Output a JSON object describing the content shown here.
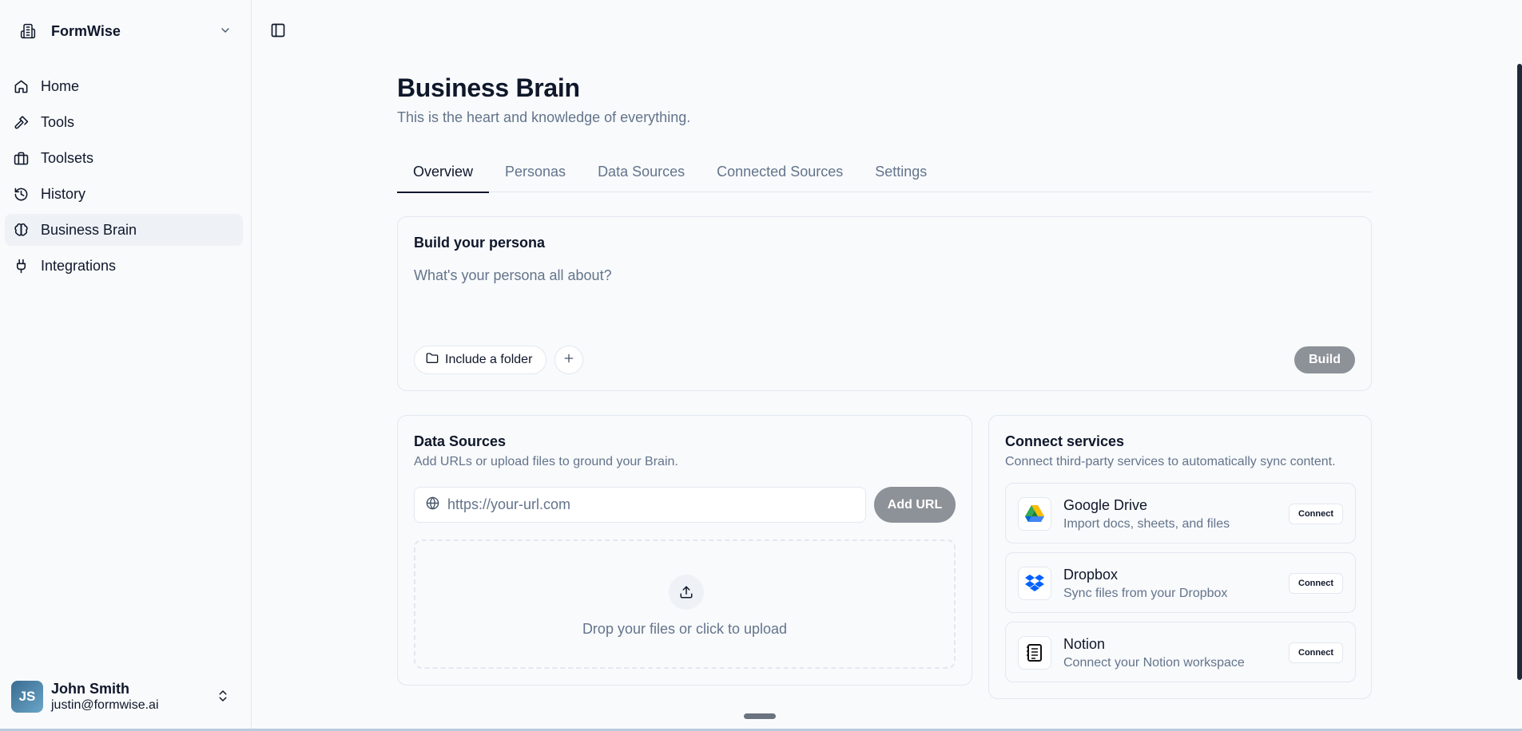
{
  "sidebar": {
    "brand": "FormWise",
    "items": [
      {
        "label": "Home",
        "icon": "home-icon"
      },
      {
        "label": "Tools",
        "icon": "hammer-icon"
      },
      {
        "label": "Toolsets",
        "icon": "briefcase-icon"
      },
      {
        "label": "History",
        "icon": "history-icon"
      },
      {
        "label": "Business Brain",
        "icon": "brain-icon",
        "active": true
      },
      {
        "label": "Integrations",
        "icon": "plug-icon"
      }
    ],
    "user": {
      "initials": "JS",
      "name": "John Smith",
      "email": "justin@formwise.ai"
    }
  },
  "page": {
    "title": "Business Brain",
    "subtitle": "This is the heart and knowledge of everything.",
    "tabs": [
      "Overview",
      "Personas",
      "Data Sources",
      "Connected Sources",
      "Settings"
    ],
    "active_tab": "Overview"
  },
  "persona": {
    "heading": "Build your persona",
    "placeholder": "What's your persona all about?",
    "folder_label": "Include a folder",
    "build_label": "Build"
  },
  "data_sources": {
    "heading": "Data Sources",
    "description": "Add URLs or upload files to ground your Brain.",
    "url_placeholder": "https://your-url.com",
    "add_url_label": "Add URL",
    "drop_text": "Drop your files or click to upload"
  },
  "connect": {
    "heading": "Connect services",
    "description": "Connect third-party services to automatically sync content.",
    "services": [
      {
        "name": "Google Drive",
        "desc": "Import docs, sheets, and files",
        "button": "Connect",
        "icon": "google-drive-icon"
      },
      {
        "name": "Dropbox",
        "desc": "Sync files from your Dropbox",
        "button": "Connect",
        "icon": "dropbox-icon"
      },
      {
        "name": "Notion",
        "desc": "Connect your Notion workspace",
        "button": "Connect",
        "icon": "notion-icon"
      }
    ]
  },
  "colors": {
    "accent_button": "#8d9198",
    "text": "#0f172a",
    "muted": "#64748b",
    "border": "#e2e8f0"
  }
}
